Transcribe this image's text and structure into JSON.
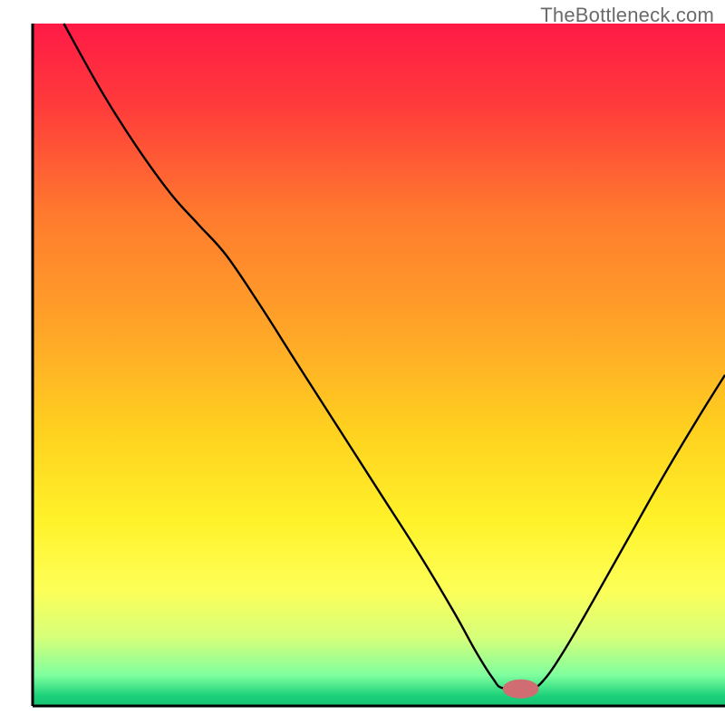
{
  "watermark": "TheBottleneck.com",
  "chart_data": {
    "type": "line",
    "title": "",
    "xlabel": "",
    "ylabel": "",
    "xlim": [
      0,
      100
    ],
    "ylim": [
      0,
      100
    ],
    "legend": false,
    "grid": false,
    "background": {
      "type": "vertical-gradient",
      "stops": [
        {
          "offset": 0.0,
          "color": "#ff1a46"
        },
        {
          "offset": 0.12,
          "color": "#ff3b3b"
        },
        {
          "offset": 0.28,
          "color": "#ff7a2e"
        },
        {
          "offset": 0.45,
          "color": "#ffa528"
        },
        {
          "offset": 0.6,
          "color": "#ffd21f"
        },
        {
          "offset": 0.73,
          "color": "#fff22a"
        },
        {
          "offset": 0.83,
          "color": "#fdff58"
        },
        {
          "offset": 0.9,
          "color": "#d6ff7a"
        },
        {
          "offset": 0.955,
          "color": "#7fff9e"
        },
        {
          "offset": 0.985,
          "color": "#1cd27a"
        },
        {
          "offset": 1.0,
          "color": "#17c072"
        }
      ]
    },
    "marker": {
      "x": 70.5,
      "y": 2.5,
      "color": "#cf6d72",
      "rx": 2.6,
      "ry": 1.4
    },
    "series": [
      {
        "name": "bottleneck-curve",
        "color": "#000000",
        "points": [
          {
            "x": 4.5,
            "y": 100.0
          },
          {
            "x": 10.0,
            "y": 90.0
          },
          {
            "x": 15.0,
            "y": 82.0
          },
          {
            "x": 20.0,
            "y": 75.0
          },
          {
            "x": 24.0,
            "y": 70.5
          },
          {
            "x": 28.0,
            "y": 66.0
          },
          {
            "x": 33.0,
            "y": 58.5
          },
          {
            "x": 38.0,
            "y": 50.5
          },
          {
            "x": 44.0,
            "y": 41.0
          },
          {
            "x": 50.0,
            "y": 31.5
          },
          {
            "x": 56.0,
            "y": 22.0
          },
          {
            "x": 61.0,
            "y": 13.5
          },
          {
            "x": 64.0,
            "y": 8.0
          },
          {
            "x": 66.5,
            "y": 4.0
          },
          {
            "x": 68.0,
            "y": 2.6
          },
          {
            "x": 72.0,
            "y": 2.6
          },
          {
            "x": 74.0,
            "y": 4.0
          },
          {
            "x": 77.0,
            "y": 8.5
          },
          {
            "x": 81.0,
            "y": 15.5
          },
          {
            "x": 86.0,
            "y": 24.5
          },
          {
            "x": 91.0,
            "y": 33.5
          },
          {
            "x": 96.0,
            "y": 42.0
          },
          {
            "x": 100.0,
            "y": 48.5
          }
        ]
      }
    ],
    "axes": {
      "left": {
        "x": 4.5,
        "y1": 3.2,
        "y2": 97.4
      },
      "bottom": {
        "y": 97.4,
        "x1": 4.5,
        "x2": 100.0
      }
    }
  }
}
